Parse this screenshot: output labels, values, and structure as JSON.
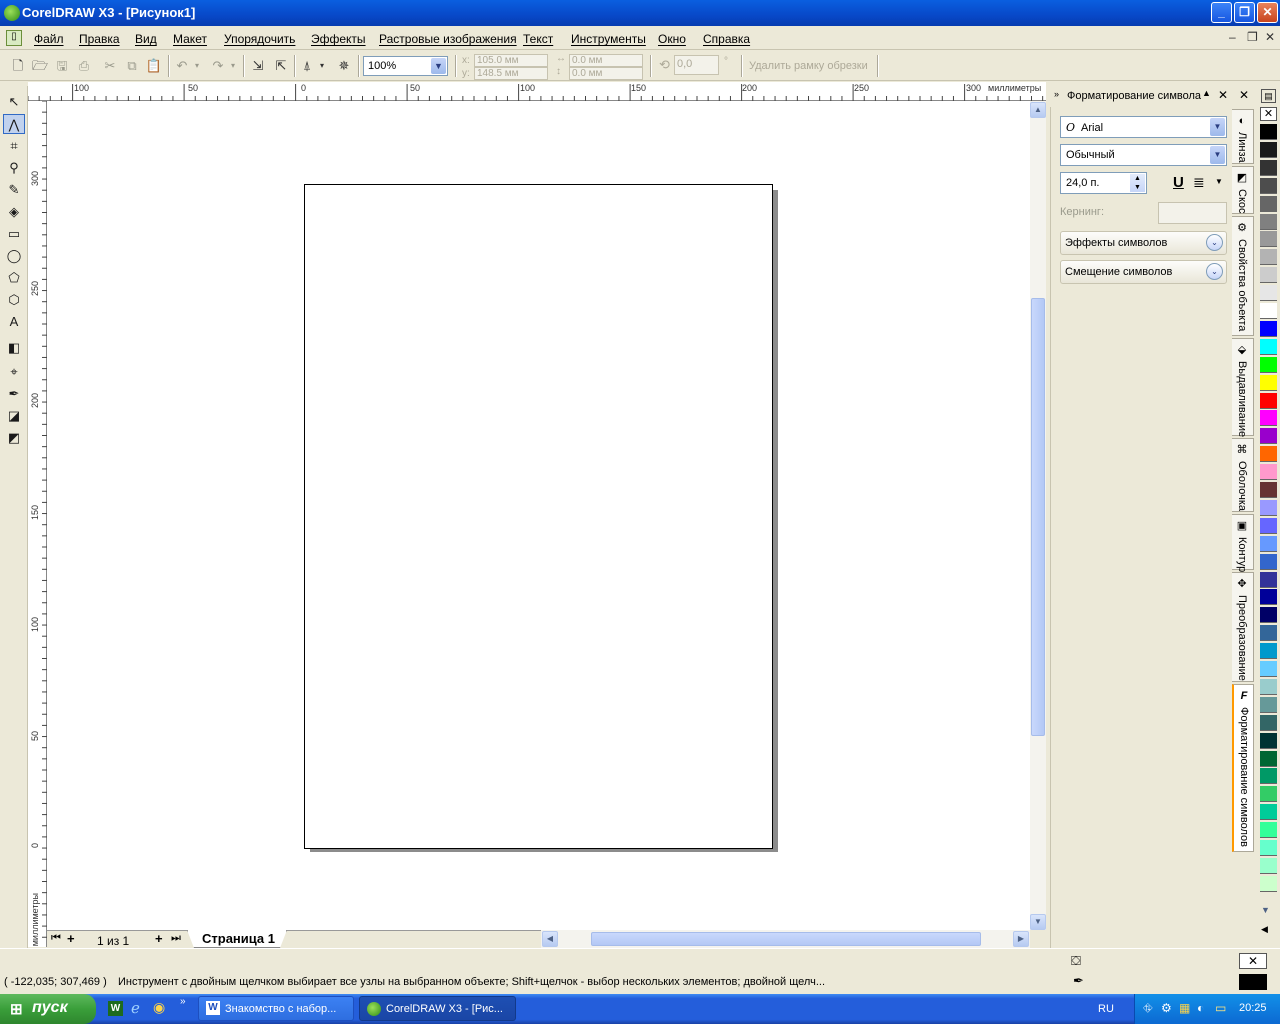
{
  "window": {
    "title": "CorelDRAW X3 - [Рисунок1]"
  },
  "menu": [
    "Файл",
    "Правка",
    "Вид",
    "Макет",
    "Упорядочить",
    "Эффекты",
    "Растровые изображения",
    "Текст",
    "Инструменты",
    "Окно",
    "Справка"
  ],
  "toolbar": {
    "zoom": "100%",
    "x_label": "x:",
    "y_label": "y:",
    "x_value": "105.0 мм",
    "y_value": "148.5 мм",
    "w_value": "0.0 мм",
    "h_value": "0.0 мм",
    "angle_value": "0,0",
    "degree": "°",
    "crop_button": "Удалить рамку обрезки"
  },
  "rulers": {
    "units": "миллиметры",
    "h_ticks": [
      "100",
      "50",
      "0",
      "50",
      "100",
      "150",
      "200",
      "250",
      "300"
    ],
    "v_ticks": [
      "300",
      "250",
      "200",
      "150",
      "100",
      "50",
      "0"
    ]
  },
  "page_nav": {
    "counter": "1 из 1",
    "tab": "Страница 1"
  },
  "docker": {
    "title": "Форматирование символа",
    "font": "Arial",
    "style": "Обычный",
    "size": "24,0 п.",
    "kerning_label": "Кернинг:",
    "sections": [
      "Эффекты символов",
      "Смещение символов"
    ],
    "tabs": [
      "Линза",
      "Скос",
      "Свойства объекта",
      "Выдавливание",
      "Оболочка",
      "Контур",
      "Преобразование",
      "Форматирование символов"
    ]
  },
  "status": {
    "coords": "( -122,035; 307,469 )",
    "message": "Инструмент с двойным щелчком выбирает все узлы на выбранном объекте; Shift+щелчок - выбор нескольких элементов; двойной щелч..."
  },
  "taskbar": {
    "start": "пуск",
    "tasks": [
      "Знакомство с набор...",
      "CorelDRAW X3 - [Рис..."
    ],
    "lang": "RU",
    "time": "20:25"
  },
  "palette_colors": [
    "#000000",
    "#1a1a1a",
    "#333333",
    "#4d4d4d",
    "#666666",
    "#808080",
    "#999999",
    "#b3b3b3",
    "#cccccc",
    "#e6e6e6",
    "#ffffff",
    "#0000ff",
    "#00ffff",
    "#00ff00",
    "#ffff00",
    "#ff0000",
    "#ff00ff",
    "#9900cc",
    "#ff6600",
    "#ff99cc",
    "#663333",
    "#9999ff",
    "#6666ff",
    "#6699ff",
    "#3366cc",
    "#333399",
    "#000099",
    "#000066",
    "#336699",
    "#0099cc",
    "#66ccff",
    "#99cccc",
    "#669999",
    "#336666",
    "#003333",
    "#006633",
    "#009966",
    "#33cc66",
    "#00cc99",
    "#33ff99",
    "#66ffcc",
    "#99ffcc",
    "#ccffcc"
  ]
}
